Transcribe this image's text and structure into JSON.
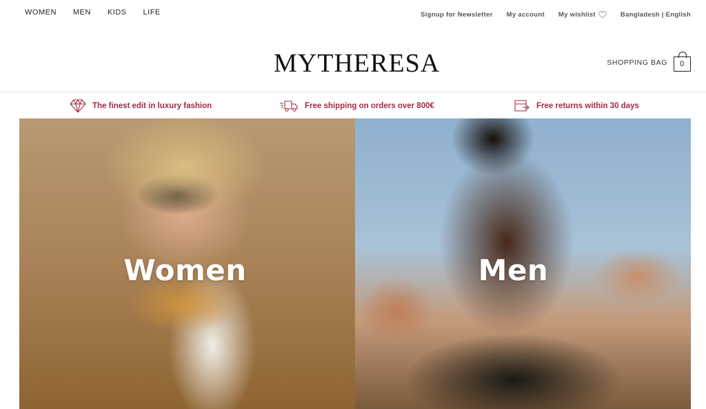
{
  "colors": {
    "accent": "#a52a3c",
    "text": "#222222"
  },
  "category_nav": [
    "WOMEN",
    "MEN",
    "KIDS",
    "LIFE"
  ],
  "utility_nav": {
    "newsletter": "Signup for Newsletter",
    "account": "My account",
    "wishlist": "My wishlist",
    "wishlist_icon": "heart-icon",
    "region": "Bangladesh | English"
  },
  "logo": "MYTHERESA",
  "bag": {
    "label": "SHOPPING BAG",
    "count": "0",
    "icon": "shopping-bag-icon"
  },
  "usps": [
    {
      "text": "The finest edit in luxury fashion",
      "icon": "diamond-icon"
    },
    {
      "text": "Free shipping on orders over 800€",
      "icon": "delivery-truck-icon"
    },
    {
      "text": "Free returns within 30 days",
      "icon": "returns-box-icon"
    }
  ],
  "heroes": [
    {
      "title": "Women"
    },
    {
      "title": "Men"
    }
  ]
}
